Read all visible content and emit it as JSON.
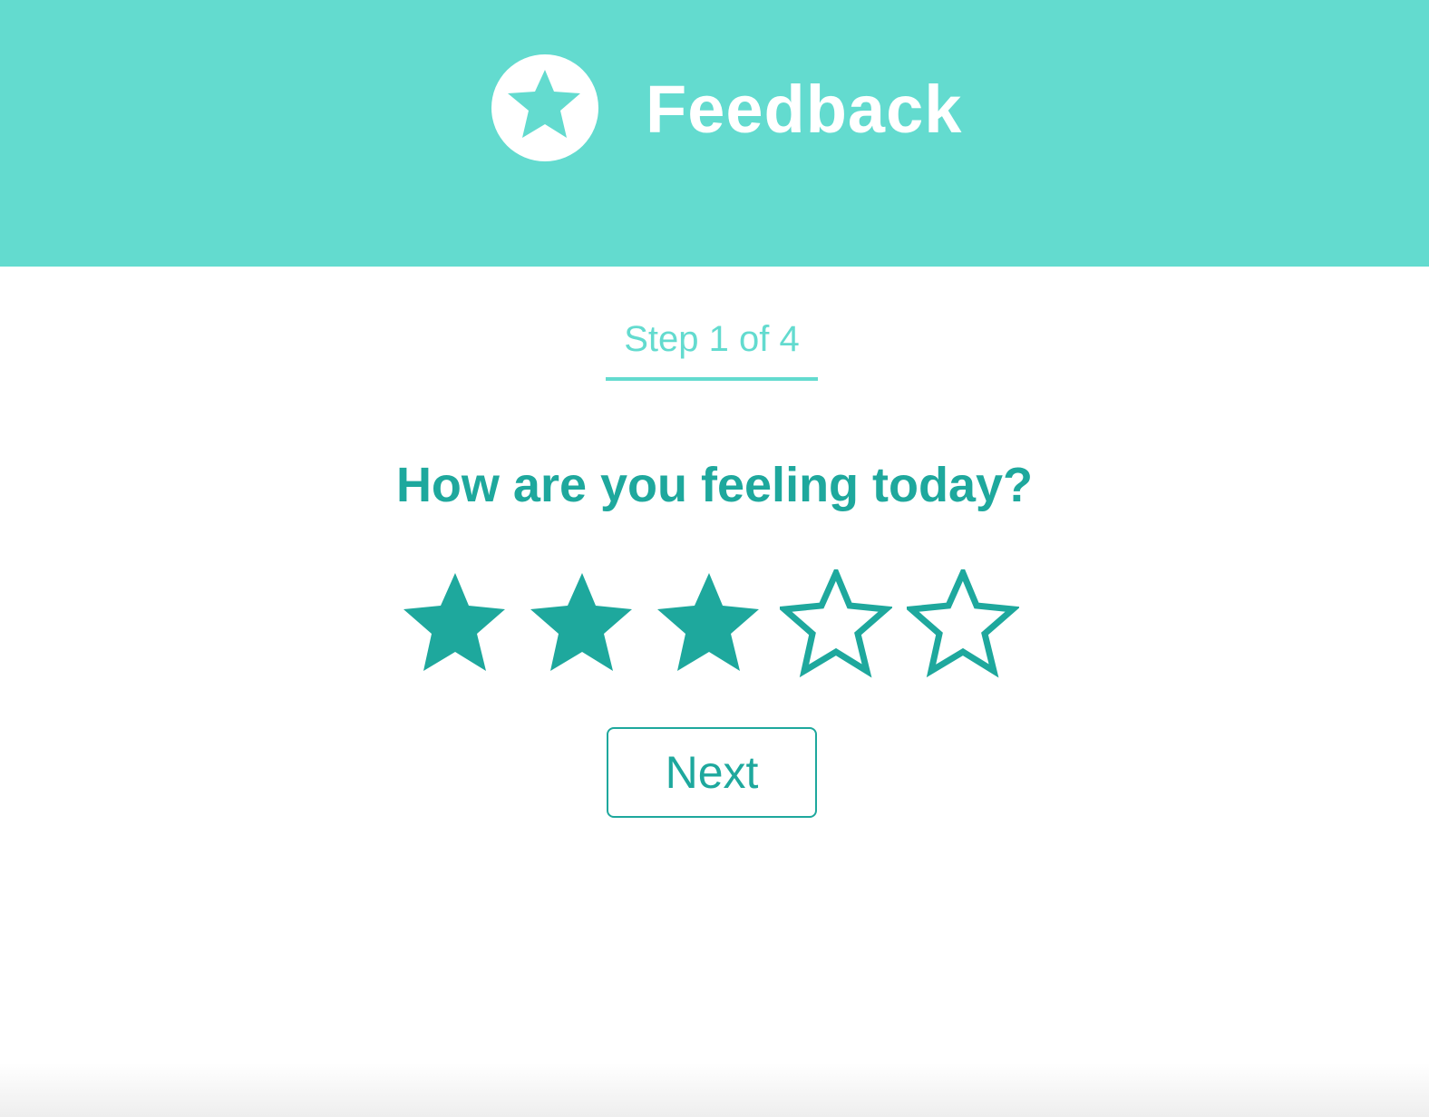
{
  "header": {
    "title": "Feedback",
    "logo_icon": "star-icon",
    "background_color": "#63dbcf"
  },
  "progress": {
    "label": "Step 1 of 4",
    "current_step": 1,
    "total_steps": 4
  },
  "question": {
    "text": "How are you feeling today?"
  },
  "rating": {
    "value": 3,
    "max": 5,
    "filled_icon": "star-filled-icon",
    "empty_icon": "star-outline-icon",
    "color": "#1ea89d"
  },
  "actions": {
    "next_label": "Next"
  }
}
